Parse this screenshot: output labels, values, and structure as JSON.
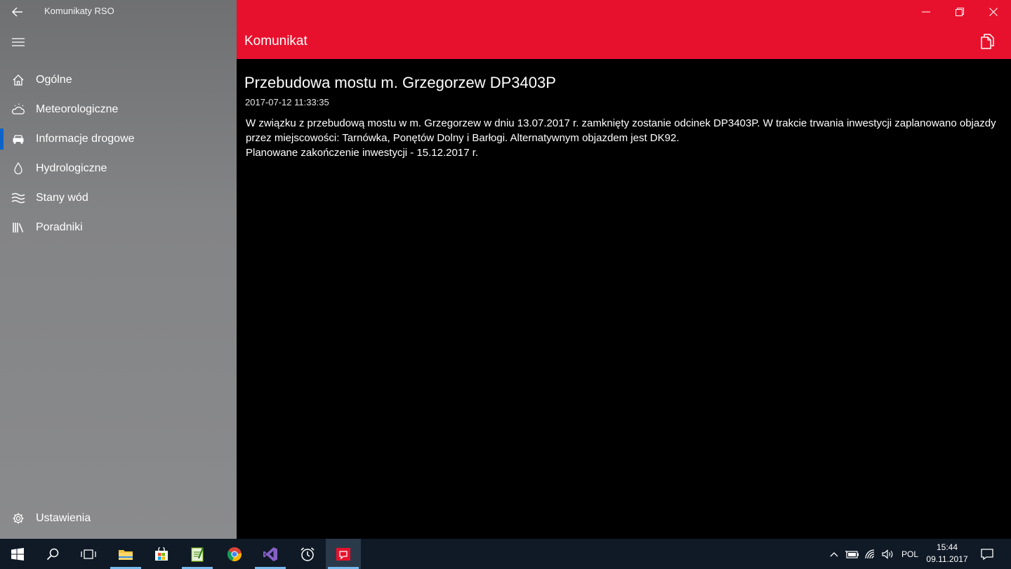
{
  "window": {
    "app_title": "Komunikaty RSO"
  },
  "sidebar": {
    "items": [
      {
        "label": "Ogólne",
        "icon": "home-icon"
      },
      {
        "label": "Meteorologiczne",
        "icon": "weather-icon"
      },
      {
        "label": "Informacje drogowe",
        "icon": "car-icon",
        "active": true
      },
      {
        "label": "Hydrologiczne",
        "icon": "drop-icon"
      },
      {
        "label": "Stany wód",
        "icon": "waves-icon"
      },
      {
        "label": "Poradniki",
        "icon": "books-icon"
      }
    ],
    "settings_label": "Ustawienia"
  },
  "header": {
    "title": "Komunikat"
  },
  "message": {
    "title": "Przebudowa mostu m. Grzegorzew DP3403P",
    "date": "2017-07-12 11:33:35",
    "body_line1": "W związku z przebudową mostu w m. Grzegorzew w dniu 13.07.2017 r. zamknięty zostanie odcinek DP3403P. W trakcie trwania inwestycji zaplanowano objazdy przez miejscowości: Tarnówka, Ponętów Dolny i Barłogi. Alternatywnym objazdem jest DK92.",
    "body_line2": "Planowane zakończenie inwestycji - 15.12.2017 r."
  },
  "taskbar": {
    "language": "POL",
    "time": "15:44",
    "date": "09.11.2017"
  },
  "colors": {
    "accent": "#e8112d",
    "active_indicator": "#0a63c9",
    "taskbar": "#0f1a26"
  }
}
